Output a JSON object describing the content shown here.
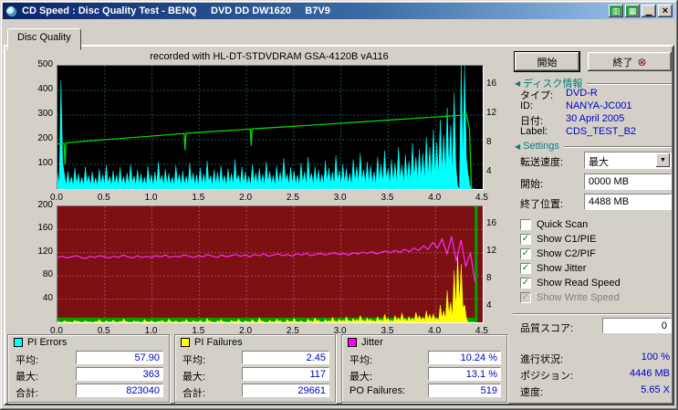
{
  "titlebar": {
    "title": "CD Speed : Disc Quality Test - BENQ     DVD DD DW1620     B7V9"
  },
  "icons": {
    "toolbar_1": "▥",
    "toolbar_2": "▦",
    "minimize": "▁",
    "close": "×",
    "check": "✓",
    "dropdown_arrow": "▼",
    "section_arrow": "◀",
    "exit": "⊗"
  },
  "tabs": {
    "disc_quality": "Disc Quality"
  },
  "chart_header": {
    "recorded_with": "recorded with HL-DT-STDVDRAM GSA-4120B vA116"
  },
  "actions": {
    "start": "開始",
    "stop": "終了"
  },
  "disc_info": {
    "title": "ディスク情報",
    "rows": [
      {
        "label": "タイプ:",
        "value": "DVD-R"
      },
      {
        "label": "ID:",
        "value": "NANYA-JC001"
      },
      {
        "label": "日付:",
        "value": "30 April 2005"
      },
      {
        "label": "Label:",
        "value": "CDS_TEST_B2"
      }
    ]
  },
  "settings": {
    "title": "Settings",
    "transfer_rate_label": "転送速度:",
    "transfer_rate_value": "最大",
    "start_label": "開始:",
    "start_value": "0000 MB",
    "end_label": "終了位置:",
    "end_value": "4488 MB",
    "checkboxes": [
      {
        "label": "Quick Scan",
        "checked": false,
        "disabled": false
      },
      {
        "label": "Show C1/PIE",
        "checked": true,
        "disabled": false
      },
      {
        "label": "Show C2/PIF",
        "checked": true,
        "disabled": false
      },
      {
        "label": "Show Jitter",
        "checked": true,
        "disabled": false
      },
      {
        "label": "Show Read Speed",
        "checked": true,
        "disabled": false
      },
      {
        "label": "Show Write Speed",
        "checked": true,
        "disabled": true
      }
    ]
  },
  "status": {
    "quality_label": "品質スコア:",
    "quality_value": "0",
    "progress_label": "進行状況:",
    "progress_value": "100 %",
    "position_label": "ポジション:",
    "position_value": "4446 MB",
    "speed_label": "速度:",
    "speed_value": "5.65 X"
  },
  "stats": {
    "pi_errors": {
      "title": "PI Errors",
      "color": "#00ffff",
      "rows": [
        [
          "平均:",
          "57.90"
        ],
        [
          "最大:",
          "363"
        ],
        [
          "合計:",
          "823040"
        ]
      ]
    },
    "pi_failures": {
      "title": "PI Failures",
      "color": "#ffff00",
      "rows": [
        [
          "平均:",
          "2.45"
        ],
        [
          "最大:",
          "117"
        ],
        [
          "合計:",
          "29661"
        ]
      ]
    },
    "jitter": {
      "title": "Jitter",
      "color": "#ff00ff",
      "rows": [
        [
          "平均:",
          "10.24 %"
        ],
        [
          "最大:",
          "13.1 %"
        ],
        [
          "PO Failures:",
          "519"
        ]
      ]
    }
  },
  "chart_data": [
    {
      "id": "top",
      "type": "area",
      "title": "PI Errors / Read Speed",
      "bg": "#000000",
      "grid_color": "#254d4d",
      "x_range": [
        0,
        4.5
      ],
      "x_ticks": [
        "0.0",
        "0.5",
        "1.0",
        "1.5",
        "2.0",
        "2.5",
        "3.0",
        "3.5",
        "4.0",
        "4.5"
      ],
      "y_left_ticks": [
        "500",
        "400",
        "300",
        "200",
        "100"
      ],
      "y_left_max": 500,
      "y_right_ticks": [
        "16",
        "12",
        "8",
        "4"
      ],
      "series": [
        {
          "name": "pi-errors",
          "style": "bars",
          "color": "#00ffff",
          "x_end": 0.982,
          "values": [
            65,
            440,
            58,
            72,
            50,
            85,
            62,
            48,
            90,
            55,
            70,
            46,
            82,
            60,
            95,
            52,
            74,
            58,
            88,
            50,
            66,
            100,
            54,
            78,
            62,
            48,
            92,
            58,
            70,
            110,
            56,
            80,
            64,
            50,
            96,
            60,
            74,
            52,
            105,
            66,
            58,
            86,
            62,
            115,
            54,
            78,
            68,
            95,
            56,
            82,
            64,
            120,
            58,
            90,
            70,
            52,
            100,
            66,
            84,
            60,
            112,
            72,
            56,
            94,
            68,
            125,
            62,
            88,
            74,
            58,
            105,
            70,
            130,
            64,
            92,
            78,
            60,
            115,
            85,
            70,
            135,
            75,
            100,
            82,
            64,
            120,
            90,
            145,
            78,
            110,
            95,
            70,
            130,
            100,
            155,
            85,
            120,
            105,
            170,
            95,
            140,
            115,
            185,
            130,
            160,
            145,
            210,
            170,
            240,
            190,
            280,
            220,
            330,
            260,
            390,
            10,
            500,
            500,
            60,
            0
          ]
        },
        {
          "name": "read-speed",
          "style": "line",
          "color": "#00e400",
          "points": [
            [
              0,
              183
            ],
            [
              0.07,
              186
            ],
            [
              0.08,
              98
            ],
            [
              0.09,
              187
            ],
            [
              0.3,
              194
            ],
            [
              0.6,
              203
            ],
            [
              0.9,
              212
            ],
            [
              1.2,
              221
            ],
            [
              1.34,
              225
            ],
            [
              1.35,
              158
            ],
            [
              1.36,
              226
            ],
            [
              1.7,
              235
            ],
            [
              2.0,
              242
            ],
            [
              2.04,
              243
            ],
            [
              2.05,
              176
            ],
            [
              2.06,
              244
            ],
            [
              2.4,
              252
            ],
            [
              2.8,
              262
            ],
            [
              3.2,
              272
            ],
            [
              3.6,
              282
            ],
            [
              4.0,
              292
            ],
            [
              4.2,
              297
            ],
            [
              4.33,
              301
            ],
            [
              4.36,
              240
            ],
            [
              4.38,
              0
            ]
          ]
        }
      ]
    },
    {
      "id": "bottom",
      "type": "area",
      "title": "PI Failures / Jitter",
      "bg": "#7c1013",
      "grid_color": "#a05050",
      "x_range": [
        0,
        4.5
      ],
      "x_ticks": [
        "0.0",
        "0.5",
        "1.0",
        "1.5",
        "2.0",
        "2.5",
        "3.0",
        "3.5",
        "4.0",
        "4.5"
      ],
      "y_left_ticks": [
        "200",
        "160",
        "120",
        "80",
        "40"
      ],
      "y_left_max": 200,
      "y_right_ticks": [
        "16",
        "12",
        "8",
        "4"
      ],
      "series": [
        {
          "name": "speed-strip",
          "style": "strip",
          "color": "#00a000",
          "height": 8,
          "x_end": 0.982
        },
        {
          "name": "end-marker",
          "style": "vline",
          "color": "#00a000",
          "x": 4.43,
          "width": 3
        },
        {
          "name": "pi-failures",
          "style": "bars",
          "color": "#ffff00",
          "x_end": 0.982,
          "values": [
            2,
            0,
            3,
            1,
            0,
            4,
            2,
            0,
            3,
            1,
            0,
            2,
            5,
            0,
            3,
            1,
            4,
            0,
            2,
            6,
            1,
            0,
            3,
            2,
            0,
            5,
            1,
            3,
            0,
            2,
            4,
            0,
            6,
            1,
            3,
            0,
            2,
            5,
            0,
            3,
            1,
            4,
            0,
            7,
            2,
            0,
            3,
            5,
            1,
            0,
            4,
            2,
            6,
            0,
            3,
            1,
            5,
            0,
            8,
            2,
            0,
            4,
            1,
            6,
            3,
            0,
            5,
            2,
            7,
            1,
            3,
            0,
            6,
            2,
            8,
            4,
            1,
            5,
            3,
            9,
            2,
            6,
            4,
            10,
            3,
            7,
            5,
            12,
            4,
            8,
            6,
            3,
            10,
            5,
            14,
            7,
            4,
            12,
            8,
            16,
            6,
            10,
            8,
            18,
            12,
            9,
            20,
            14,
            15,
            8,
            30,
            20,
            55,
            35,
            90,
            117,
            100,
            30,
            0,
            0
          ]
        },
        {
          "name": "jitter",
          "style": "linevals",
          "color": "#ff2bff",
          "x_end": 0.982,
          "values": [
            112,
            114,
            111,
            113,
            115,
            112,
            110,
            114,
            112,
            115,
            113,
            111,
            114,
            112,
            116,
            113,
            111,
            115,
            112,
            114,
            112,
            115,
            113,
            116,
            112,
            114,
            113,
            116,
            114,
            112,
            115,
            113,
            117,
            114,
            112,
            116,
            113,
            115,
            117,
            114,
            116,
            113,
            117,
            115,
            118,
            114,
            116,
            118,
            115,
            117,
            114,
            118,
            116,
            119,
            115,
            117,
            119,
            116,
            118,
            120,
            117,
            119,
            116,
            120,
            118,
            121,
            119,
            122,
            118,
            121,
            123,
            120,
            124,
            121,
            126,
            122,
            128,
            124,
            132,
            126,
            138,
            128,
            144,
            118,
            148,
            106,
            142,
            96,
            120,
            70
          ]
        }
      ]
    }
  ]
}
